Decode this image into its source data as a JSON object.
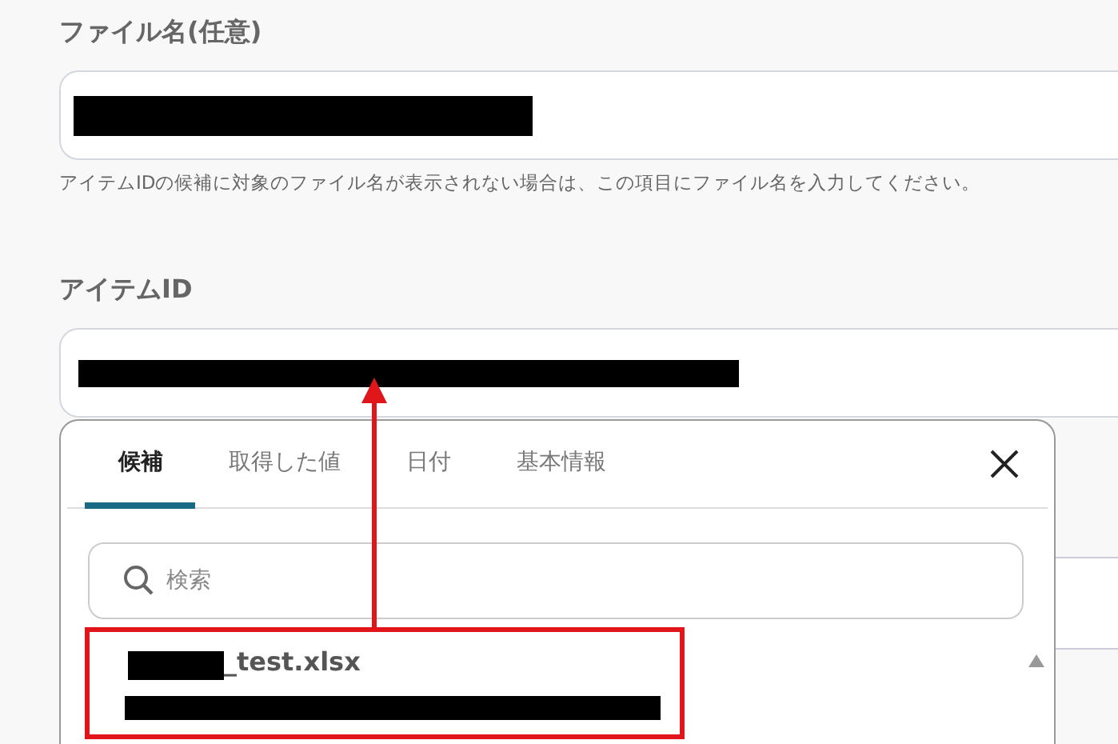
{
  "fields": [
    {
      "label": "ファイル名(任意)",
      "hint": "アイテムIDの候補に対象のファイル名が表示されない場合は、この項目にファイル名を入力してください。"
    },
    {
      "label": "アイテムID"
    }
  ],
  "popup": {
    "tabs": [
      {
        "label": "候補",
        "selected": true
      },
      {
        "label": "取得した値",
        "selected": false
      },
      {
        "label": "日付",
        "selected": false
      },
      {
        "label": "基本情報",
        "selected": false
      }
    ],
    "search": {
      "placeholder": "検索"
    },
    "items": [
      {
        "title": "_test.xlsx"
      }
    ]
  }
}
